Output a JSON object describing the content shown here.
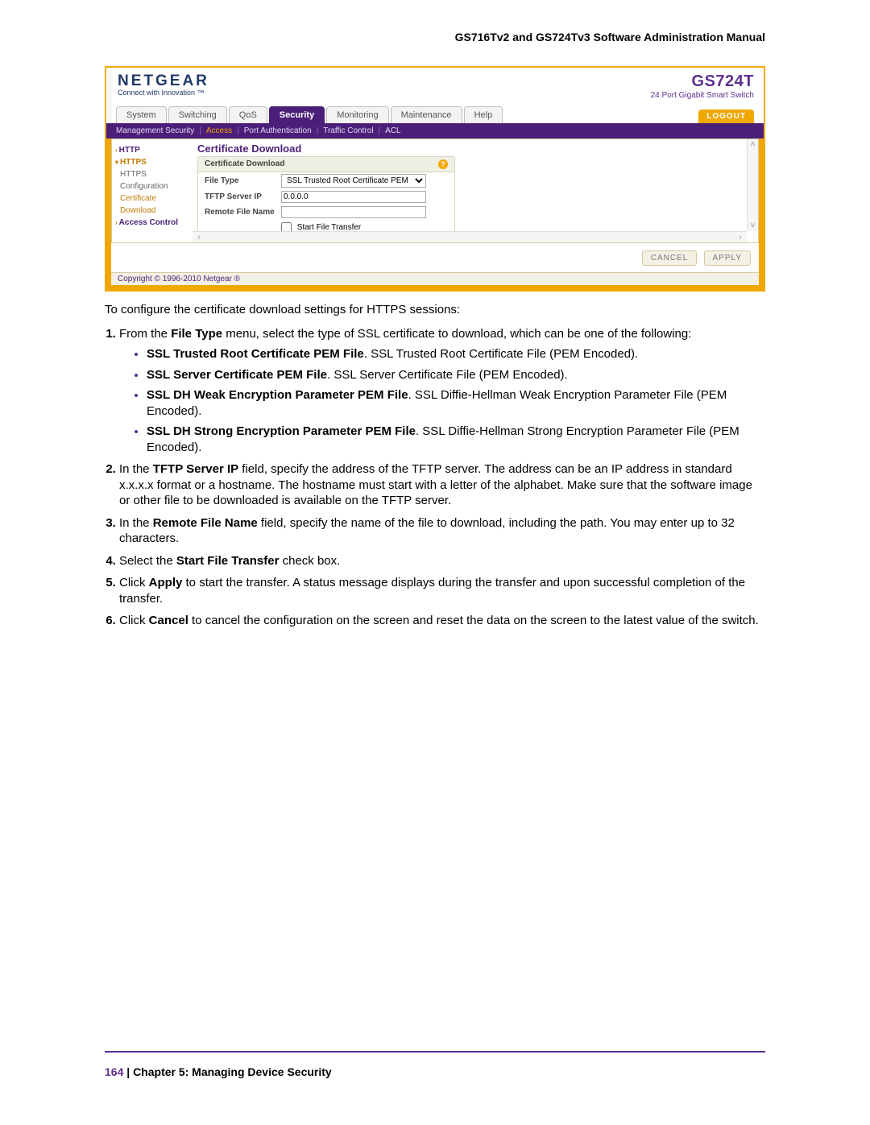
{
  "header": {
    "manual_title": "GS716Tv2 and GS724Tv3 Software Administration Manual"
  },
  "ui": {
    "brand": {
      "logo": "NETGEAR",
      "tagline": "Connect with Innovation ™"
    },
    "model": {
      "name": "GS724T",
      "sub": "24 Port Gigabit Smart Switch"
    },
    "tabs": {
      "t0": "System",
      "t1": "Switching",
      "t2": "QoS",
      "t3": "Security",
      "t4": "Monitoring",
      "t5": "Maintenance",
      "t6": "Help"
    },
    "logout": "LOGOUT",
    "subtabs": {
      "s0": "Management Security",
      "s1": "Access",
      "s2": "Port Authentication",
      "s3": "Traffic Control",
      "s4": "ACL"
    },
    "side": {
      "http": "HTTP",
      "https": "HTTPS",
      "cfg": "HTTPS Configuration",
      "cert": "Certificate Download",
      "ac": "Access Control"
    },
    "panel": {
      "title": "Certificate Download",
      "box_title": "Certificate Download",
      "file_type_label": "File Type",
      "file_type_value": "SSL Trusted Root Certificate PEM File",
      "tftp_label": "TFTP Server IP",
      "tftp_value": "0.0.0.0",
      "remote_label": "Remote File Name",
      "remote_value": "",
      "cb_label": "Start File Transfer"
    },
    "buttons": {
      "cancel": "CANCEL",
      "apply": "APPLY"
    },
    "copyright": "Copyright © 1996-2010 Netgear ®"
  },
  "text": {
    "intro": "To configure the certificate download settings for HTTPS sessions:",
    "s1a": "From the ",
    "s1b": "File Type",
    "s1c": " menu, select the type of SSL certificate to download, which can be one of the following:",
    "b1a": "SSL Trusted Root Certificate PEM File",
    "b1b": ". SSL Trusted Root Certificate File (PEM Encoded).",
    "b2a": "SSL Server Certificate PEM File",
    "b2b": ". SSL Server Certificate File (PEM Encoded).",
    "b3a": "SSL DH Weak Encryption Parameter PEM File",
    "b3b": ". SSL Diffie-Hellman Weak Encryption Parameter File (PEM Encoded).",
    "b4a": "SSL DH Strong Encryption Parameter PEM File",
    "b4b": ". SSL Diffie-Hellman Strong Encryption Parameter File (PEM Encoded).",
    "s2a": "In the ",
    "s2b": "TFTP Server IP",
    "s2c": " field, specify the address of the TFTP server. The address can be an IP address in standard x.x.x.x format or a hostname. The hostname must start with a letter of the alphabet. Make sure that the software image or other file to be downloaded is available on the TFTP server.",
    "s3a": "In the ",
    "s3b": "Remote File Name",
    "s3c": " field, specify the name of the file to download, including the path. You may enter up to 32 characters.",
    "s4a": "Select the ",
    "s4b": "Start File Transfer",
    "s4c": " check box.",
    "s5a": "Click ",
    "s5b": "Apply",
    "s5c": " to start the transfer. A status message displays during the transfer and upon successful completion of the transfer.",
    "s6a": "Click ",
    "s6b": "Cancel",
    "s6c": " to cancel the configuration on the screen and reset the data on the screen to the latest value of the switch."
  },
  "footer": {
    "page": "164",
    "sep": "   |   ",
    "chapter": "Chapter 5:  Managing Device Security"
  }
}
